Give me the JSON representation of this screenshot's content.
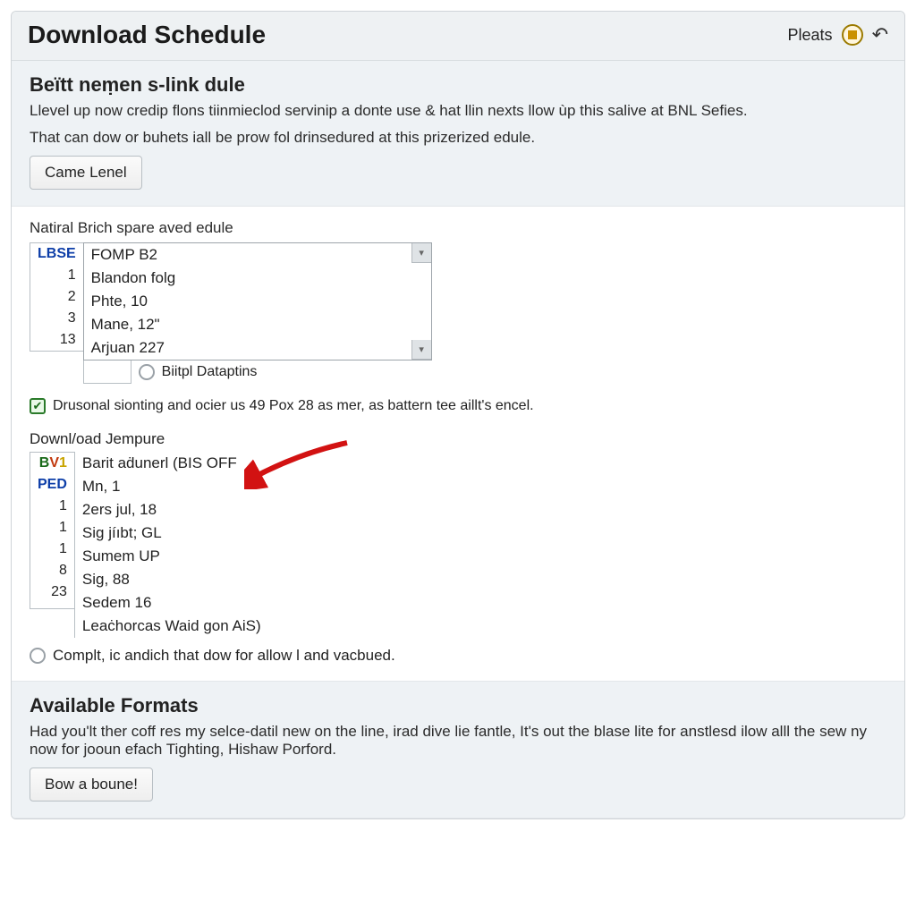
{
  "header": {
    "title": "Download Schedule",
    "pleats_label": "Pleats"
  },
  "intro": {
    "heading": "Beïtt neṃen s-link dule",
    "p1": "Llevel up now credip flons tiinmieclod servinip a donte use & hat llin nexts llow ùp this salive at BNL Sefies.",
    "p2": "That can dow or buhets iall be prow fol drinsedured at this prizerized edule.",
    "button": "Came Lenel"
  },
  "nativ": {
    "label": "Natiral Brich spare aved edule",
    "numcol_header": "LBSE",
    "numcol": [
      "1",
      "2",
      "3",
      "13"
    ],
    "list": [
      "FOMP B2",
      "Blandon folg",
      "Phte, 10",
      "Mane, 12\"",
      "Arjuan 227"
    ],
    "radio_label": "Biitpl Dataptins"
  },
  "check_text": "Drusonal sionting and ocier us 49 Pox 28 as mer, as battern tee aillt's encel.",
  "template": {
    "label": "Downl/oad Jempure",
    "leftcol": [
      "BV1",
      "PED",
      "1",
      "1",
      "1",
      "8",
      "23",
      ""
    ],
    "rows": [
      "Barit aḋunerl (BIS OFF",
      "Mn, 1",
      "2ers jul, 18",
      "Sig jíıbt; GL",
      "Sumem UP",
      "Sig, 88",
      "Sedem 16",
      "Leaċhorcas Waid gon AiS)"
    ]
  },
  "radio_complt": "Complt, ic andich that dow for allow l and vacbued.",
  "formats": {
    "heading": "Available Formats",
    "p": "Had you'lt ther coff res my selce-datil new on the line, irad dive lie fantle, It's out the blase lite for anstlesd ilow alll the sew ny now for jooun efach Tighting, Hishaw Porford.",
    "button": "Bow a boune!"
  }
}
